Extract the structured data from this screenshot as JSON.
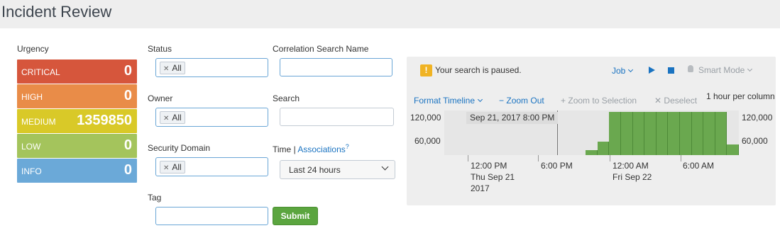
{
  "page": {
    "title": "Incident Review"
  },
  "urgency": {
    "label": "Urgency",
    "items": [
      {
        "name": "CRITICAL",
        "count": "0",
        "color": "#d6563c"
      },
      {
        "name": "HIGH",
        "count": "0",
        "color": "#e98c48"
      },
      {
        "name": "MEDIUM",
        "count": "1359850",
        "color": "#d9c928"
      },
      {
        "name": "LOW",
        "count": "0",
        "color": "#a4c45c"
      },
      {
        "name": "INFO",
        "count": "0",
        "color": "#6ba9d8"
      }
    ]
  },
  "filters": {
    "status": {
      "label": "Status",
      "token": "All"
    },
    "owner": {
      "label": "Owner",
      "token": "All"
    },
    "security_domain": {
      "label": "Security Domain",
      "token": "All"
    },
    "tag": {
      "label": "Tag",
      "value": ""
    },
    "correlation_search_name": {
      "label": "Correlation Search Name",
      "value": ""
    },
    "search": {
      "label": "Search",
      "value": ""
    },
    "time": {
      "label": "Time",
      "separator": "|",
      "link": "Associations",
      "help": "?",
      "selected": "Last 24 hours"
    },
    "submit_label": "Submit"
  },
  "job_panel": {
    "message": "Your search is paused.",
    "job_label": "Job",
    "smart_mode_label": "Smart Mode",
    "format_timeline_label": "Format Timeline",
    "zoom_out_label": "Zoom Out",
    "zoom_to_selection_label": "Zoom to Selection",
    "deselect_label": "Deselect",
    "scale_label": "1 hour per column"
  },
  "chart_data": {
    "type": "bar",
    "y_ticks_left": [
      "120,000",
      "60,000"
    ],
    "y_ticks_right": [
      "120,000",
      "60,000"
    ],
    "selected_time": "Sep 21, 2017 8:00 PM",
    "x_labels": [
      {
        "line1": "12:00 PM",
        "line2": "Thu Sep 21",
        "line3": "2017"
      },
      {
        "line1": "6:00 PM",
        "line2": "",
        "line3": ""
      },
      {
        "line1": "12:00 AM",
        "line2": "Fri Sep 22",
        "line3": ""
      },
      {
        "line1": "6:00 AM",
        "line2": "",
        "line3": ""
      }
    ],
    "values": [
      0,
      0,
      0,
      0,
      0,
      0,
      0,
      0,
      0,
      0,
      0,
      0,
      15000,
      40000,
      125000,
      125000,
      125000,
      125000,
      125000,
      125000,
      125000,
      125000,
      125000,
      125000,
      30000
    ],
    "ylim": [
      0,
      130000
    ],
    "bar_color": "#6aa84f"
  }
}
